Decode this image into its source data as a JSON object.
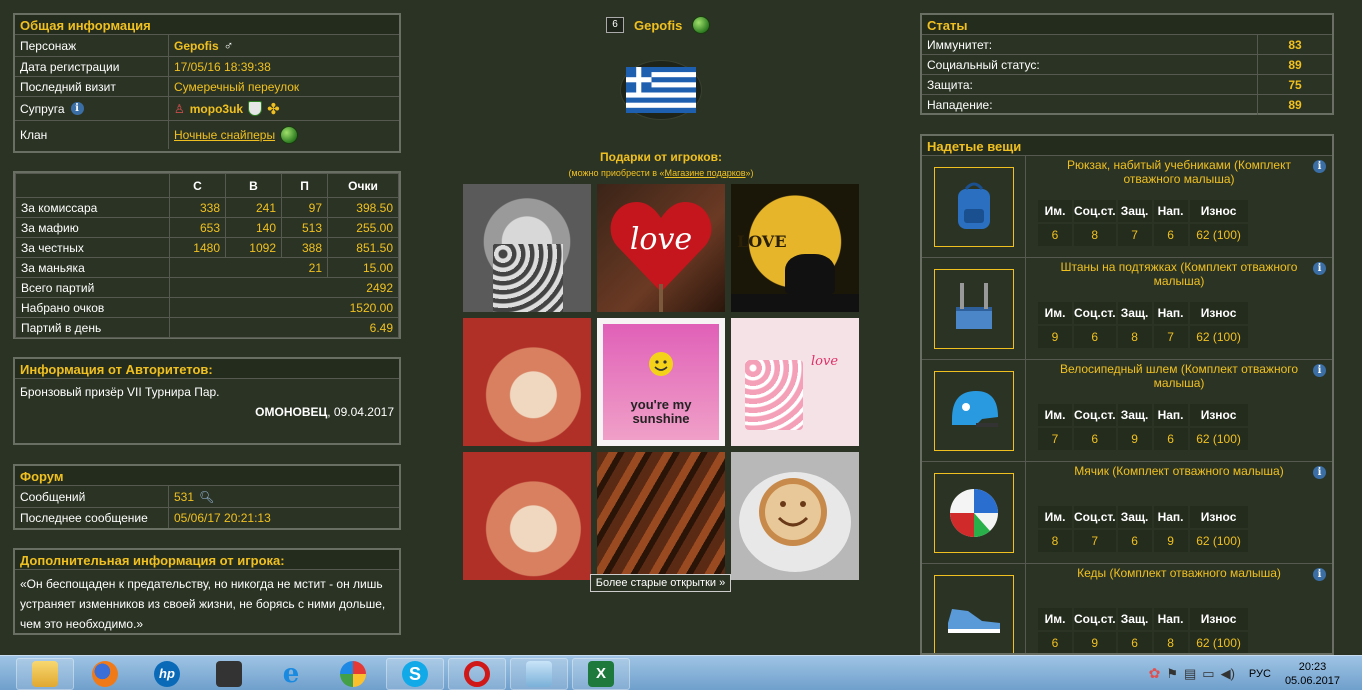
{
  "general": {
    "title": "Общая информация",
    "rows": [
      {
        "label": "Персонаж",
        "value": "Gepofis"
      },
      {
        "label": "Дата регистрации",
        "value": "17/05/16 18:39:38"
      },
      {
        "label": "Последний визит",
        "value": "Сумеречный переулок"
      },
      {
        "label": "Супруга",
        "value": "mopo3uk"
      },
      {
        "label": "Клан",
        "value": "Ночные снайперы"
      }
    ]
  },
  "scores": {
    "headers": [
      "",
      "С",
      "В",
      "П",
      "Очки"
    ],
    "rows": [
      {
        "label": "За комиссара",
        "c": "338",
        "v": "241",
        "p": "97",
        "points": "398.50"
      },
      {
        "label": "За мафию",
        "c": "653",
        "v": "140",
        "p": "513",
        "points": "255.00"
      },
      {
        "label": "За честных",
        "c": "1480",
        "v": "1092",
        "p": "388",
        "points": "851.50"
      }
    ],
    "maniac": {
      "label": "За маньяка",
      "p": "21",
      "points": "15.00"
    },
    "totals": [
      {
        "label": "Всего партий",
        "value": "2492"
      },
      {
        "label": "Набрано очков",
        "value": "1520.00"
      },
      {
        "label": "Партий в день",
        "value": "6.49"
      }
    ]
  },
  "authorities": {
    "title": "Информация от Авторитетов:",
    "text": "Бронзовый призёр VII Турнира Пар.",
    "author": "ОМОНОВЕЦ",
    "date": ", 09.04.2017"
  },
  "forum": {
    "title": "Форум",
    "rows": [
      {
        "label": "Сообщений",
        "value": "531"
      },
      {
        "label": "Последнее сообщение",
        "value": "05/06/17 20:21:13"
      }
    ]
  },
  "extra": {
    "title": "Дополнительная информация от игрока:",
    "text": "«Он беспощаден к предательству, но никогда не мстит - он лишь устраняет изменников из своей жизни, не борясь с ними дольше, чем это необходимо.»"
  },
  "profile": {
    "level": "6",
    "name": "Gepofis",
    "gifts_title": "Подарки от игроков:",
    "gifts_sub_prefix": "(можно приобрести в «",
    "gifts_sub_link": "Магазине подарков",
    "gifts_sub_suffix": "»)",
    "older_button": "Более старые открытки »"
  },
  "gifts": [
    {
      "name": "girl-photo",
      "text": ""
    },
    {
      "name": "love-heart",
      "text": "love"
    },
    {
      "name": "love-bears",
      "text": "LOVE"
    },
    {
      "name": "hands-coffee",
      "text": ""
    },
    {
      "name": "sunshine-card",
      "text": "you're my sunshine"
    },
    {
      "name": "love-mug",
      "text": "love"
    },
    {
      "name": "hands-coffee-2",
      "text": ""
    },
    {
      "name": "kebabs",
      "text": ""
    },
    {
      "name": "smiley-coffee",
      "text": ""
    }
  ],
  "stats": {
    "title": "Статы",
    "rows": [
      {
        "label": "Иммунитет:",
        "value": "83"
      },
      {
        "label": "Социальный статус:",
        "value": "89"
      },
      {
        "label": "Защита:",
        "value": "75"
      },
      {
        "label": "Нападение:",
        "value": "89"
      }
    ]
  },
  "equipment": {
    "title": "Надетые вещи",
    "headers": [
      "Им.",
      "Соц.ст.",
      "Защ.",
      "Нап.",
      "Износ"
    ],
    "items": [
      {
        "name": "Рюкзак, набитый учебниками (Комплект отважного малыша)",
        "icon": "backpack-icon",
        "values": [
          "6",
          "8",
          "7",
          "6",
          "62 (100)"
        ]
      },
      {
        "name": "Штаны на подтяжках (Комплект отважного малыша)",
        "icon": "pants-icon",
        "values": [
          "9",
          "6",
          "8",
          "7",
          "62 (100)"
        ]
      },
      {
        "name": "Велосипедный шлем (Комплект отважного малыша)",
        "icon": "helmet-icon",
        "values": [
          "7",
          "6",
          "9",
          "6",
          "62 (100)"
        ]
      },
      {
        "name": "Мячик (Комплект отважного малыша)",
        "icon": "ball-icon",
        "values": [
          "8",
          "7",
          "6",
          "9",
          "62 (100)"
        ]
      },
      {
        "name": "Кеды (Комплект отважного малыша)",
        "icon": "sneakers-icon",
        "values": [
          "6",
          "9",
          "6",
          "8",
          "62 (100)"
        ]
      }
    ]
  },
  "taskbar": {
    "lang": "РУС",
    "time": "20:23",
    "date": "05.06.2017"
  }
}
